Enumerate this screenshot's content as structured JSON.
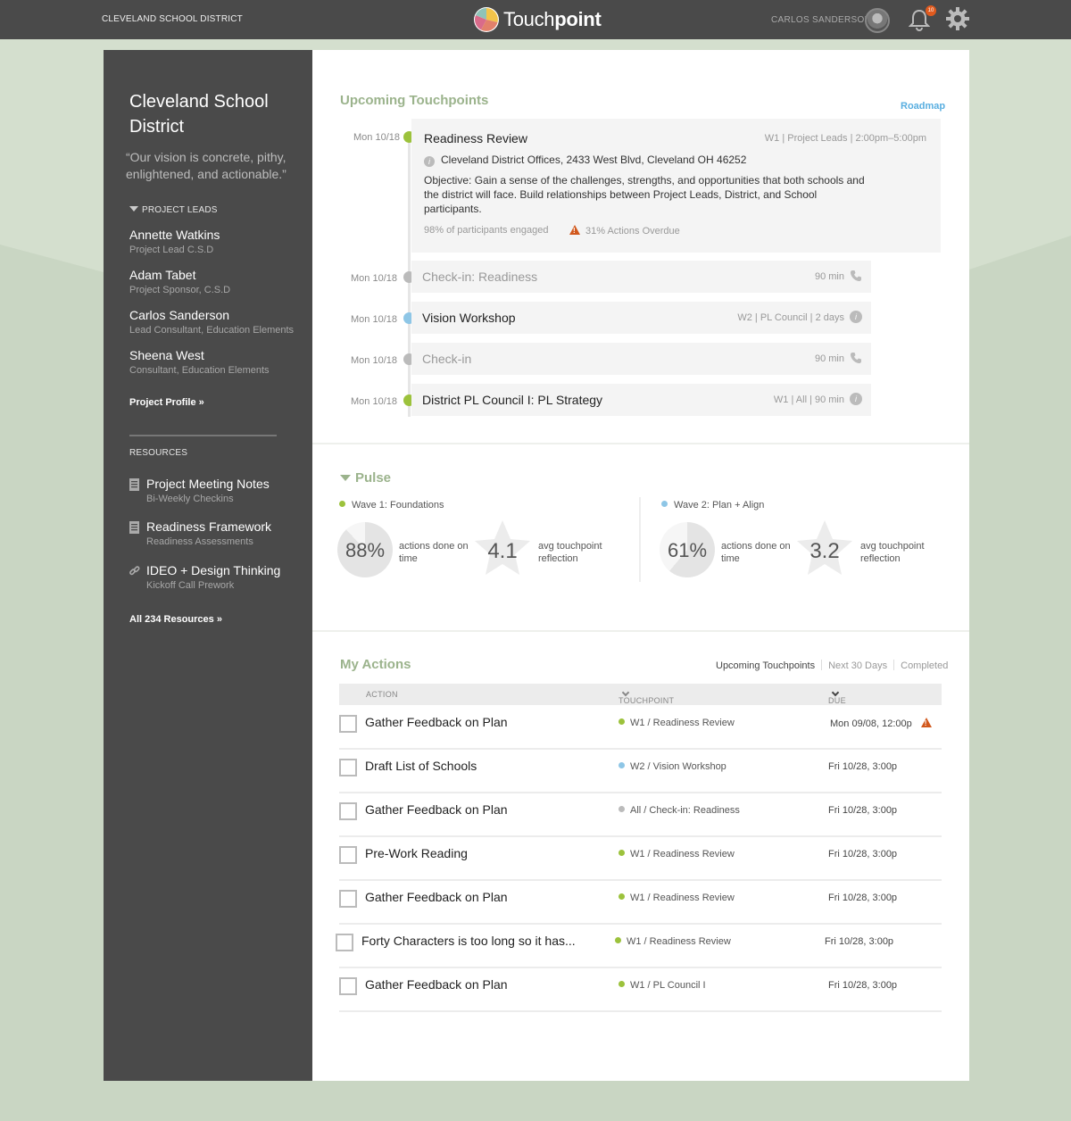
{
  "header": {
    "district": "CLEVELAND SCHOOL DISTRICT",
    "app_name_light": "Touch",
    "app_name_bold": "point",
    "user_name": "CARLOS SANDERSON",
    "notification_count": "10"
  },
  "sidebar": {
    "title": "Cleveland School District",
    "vision": "“Our vision is concrete, pithy, enlightened, and actionable.”",
    "leads_label": "PROJECT LEADS",
    "people": [
      {
        "name": "Annette Watkins",
        "role": "Project Lead C.S.D"
      },
      {
        "name": "Adam Tabet",
        "role": "Project Sponsor, C.S.D"
      },
      {
        "name": "Carlos Sanderson",
        "role": "Lead Consultant, Education Elements"
      },
      {
        "name": "Sheena West",
        "role": "Consultant, Education Elements"
      }
    ],
    "profile_link": "Project Profile »",
    "resources_label": "RESOURCES",
    "resources": [
      {
        "name": "Project Meeting Notes",
        "sub": "Bi-Weekly Checkins",
        "icon": "document-icon"
      },
      {
        "name": "Readiness Framework",
        "sub": "Readiness Assessments",
        "icon": "document-icon"
      },
      {
        "name": "IDEO + Design Thinking",
        "sub": "Kickoff Call Prework",
        "icon": "link-icon"
      }
    ],
    "all_resources_link": "All 234 Resources »"
  },
  "upcoming": {
    "title": "Upcoming Touchpoints",
    "roadmap_link": "Roadmap",
    "featured": {
      "date": "Mon 10/18",
      "name": "Readiness Review",
      "meta": "W1  |  Project Leads   |  2:00pm–5:00pm",
      "address": "Cleveland District Offices, 2433 West Blvd, Cleveland OH 46252",
      "objective": "Objective: Gain a sense of the challenges, strengths, and opportunities that both schools and the district will face. Build relationships between Project Leads, District, and School participants.",
      "engaged": "98% of participants engaged",
      "overdue": "31% Actions Overdue",
      "dot_color": "#9cc23c"
    },
    "items": [
      {
        "date": "Mon 10/18",
        "name": "Check-in: Readiness",
        "meta": "90 min",
        "icon": "phone-icon",
        "dot_color": "#bbbbbb",
        "muted": true
      },
      {
        "date": "Mon 10/18",
        "name": "Vision Workshop",
        "meta": "W2  |  PL Council   |  2 days",
        "icon": "info-icon",
        "dot_color": "#8ec6e6",
        "muted": false
      },
      {
        "date": "Mon 10/18",
        "name": "Check-in",
        "meta": "90 min",
        "icon": "phone-icon",
        "dot_color": "#bbbbbb",
        "muted": true
      },
      {
        "date": "Mon 10/18",
        "name": "District PL Council I: PL Strategy",
        "meta": "W1    |  All   |  90 min",
        "icon": "info-icon",
        "dot_color": "#9cc23c",
        "muted": false
      }
    ]
  },
  "pulse": {
    "title": "Pulse",
    "waves": [
      {
        "label": "Wave 1: Foundations",
        "dot_color": "#9cc23c",
        "pct_value": 88,
        "pct_text": "88%",
        "pct_label": "actions done on time",
        "rating": "4.1",
        "rating_label": "avg touchpoint reflection"
      },
      {
        "label": "Wave 2: Plan + Align",
        "dot_color": "#8ec6e6",
        "pct_value": 61,
        "pct_text": "61%",
        "pct_label": "actions done on time",
        "rating": "3.2",
        "rating_label": "avg touchpoint reflection"
      }
    ]
  },
  "actions": {
    "title": "My Actions",
    "tabs": [
      "Upcoming Touchpoints",
      "Next 30 Days",
      "Completed"
    ],
    "active_tab": 0,
    "columns": {
      "action": "ACTION",
      "touchpoint": "TOUCHPOINT",
      "due": "DUE"
    },
    "rows": [
      {
        "name": "Gather Feedback on Plan",
        "touchpoint": "W1 / Readiness Review",
        "dot_color": "#9cc23c",
        "due": "Mon 09/08, 12:00p",
        "overdue": true
      },
      {
        "name": "Draft List of Schools",
        "touchpoint": "W2 / Vision Workshop",
        "dot_color": "#8ec6e6",
        "due": "Fri 10/28, 3:00p",
        "overdue": false
      },
      {
        "name": "Gather Feedback on Plan",
        "touchpoint": "All / Check-in: Readiness",
        "dot_color": "#bbbbbb",
        "due": "Fri 10/28, 3:00p",
        "overdue": false
      },
      {
        "name": "Pre-Work Reading",
        "touchpoint": "W1 / Readiness Review",
        "dot_color": "#9cc23c",
        "due": "Fri 10/28, 3:00p",
        "overdue": false
      },
      {
        "name": "Gather Feedback on Plan",
        "touchpoint": "W1 / Readiness Review",
        "dot_color": "#9cc23c",
        "due": "Fri 10/28, 3:00p",
        "overdue": false
      },
      {
        "name": "Forty Characters is too long so it has...",
        "touchpoint": "W1 / Readiness Review",
        "dot_color": "#9cc23c",
        "due": "Fri 10/28, 3:00p",
        "overdue": false
      },
      {
        "name": "Gather Feedback on Plan",
        "touchpoint": "W1 / PL Council I",
        "dot_color": "#9cc23c",
        "due": "Fri 10/28, 3:00p",
        "overdue": false
      }
    ]
  },
  "colors": {
    "accent_green": "#9bb38c",
    "link_blue": "#58aee0",
    "warning": "#d1581c",
    "sidebar_bg": "#4a4a4a"
  }
}
